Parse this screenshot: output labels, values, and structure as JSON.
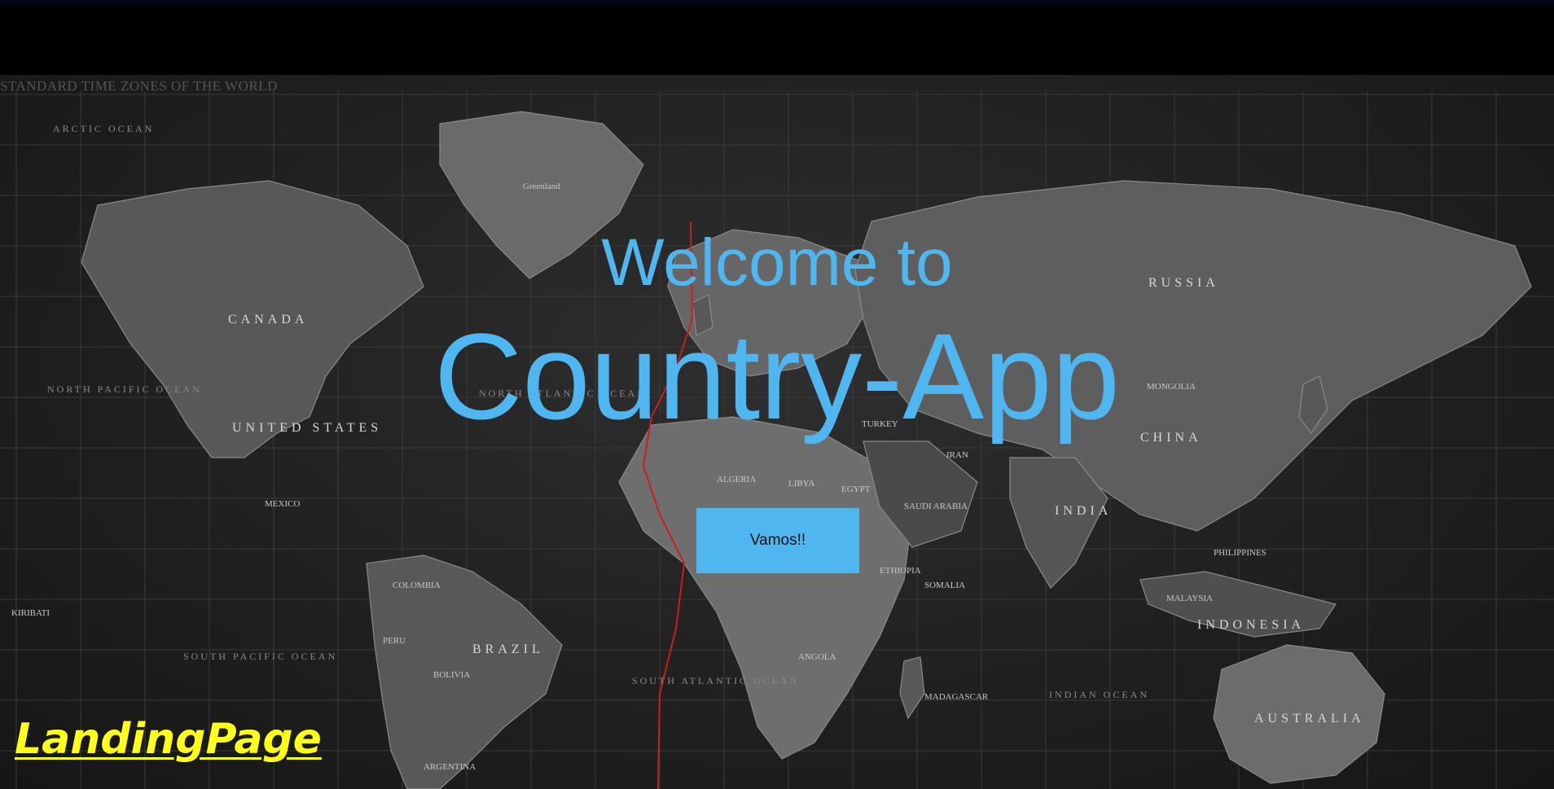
{
  "map": {
    "title": "STANDARD TIME ZONES OF THE WORLD",
    "labels": [
      {
        "text": "CANADA",
        "cls": "big"
      },
      {
        "text": "UNITED STATES",
        "cls": "big"
      },
      {
        "text": "RUSSIA",
        "cls": "big"
      },
      {
        "text": "CHINA",
        "cls": "big"
      },
      {
        "text": "BRAZIL",
        "cls": "big"
      },
      {
        "text": "INDIA",
        "cls": "big"
      },
      {
        "text": "AUSTRALIA",
        "cls": "big"
      },
      {
        "text": "INDONESIA",
        "cls": "big"
      },
      {
        "text": "MONGOLIA",
        "cls": "mid"
      },
      {
        "text": "Greenland",
        "cls": "mid"
      },
      {
        "text": "MEXICO",
        "cls": "mid"
      },
      {
        "text": "ALGERIA",
        "cls": "mid"
      },
      {
        "text": "LIBYA",
        "cls": "mid"
      },
      {
        "text": "EGYPT",
        "cls": "mid"
      },
      {
        "text": "SAUDI ARABIA",
        "cls": "mid"
      },
      {
        "text": "IRAN",
        "cls": "mid"
      },
      {
        "text": "ANGOLA",
        "cls": "mid"
      },
      {
        "text": "PERU",
        "cls": "mid"
      },
      {
        "text": "BOLIVIA",
        "cls": "mid"
      },
      {
        "text": "ARGENTINA",
        "cls": "mid"
      },
      {
        "text": "KIRIBATI",
        "cls": "mid"
      },
      {
        "text": "PHILIPPINES",
        "cls": "mid"
      },
      {
        "text": "MALAYSIA",
        "cls": "mid"
      },
      {
        "text": "ETHIOPIA",
        "cls": "mid"
      },
      {
        "text": "SOMALIA",
        "cls": "mid"
      },
      {
        "text": "MADAGASCAR",
        "cls": "mid"
      },
      {
        "text": "TURKEY",
        "cls": "mid"
      },
      {
        "text": "COLOMBIA",
        "cls": "mid"
      },
      {
        "text": "NORTH PACIFIC OCEAN",
        "cls": "ocean"
      },
      {
        "text": "SOUTH PACIFIC OCEAN",
        "cls": "ocean"
      },
      {
        "text": "NORTH ATLANTIC OCEAN",
        "cls": "ocean"
      },
      {
        "text": "SOUTH ATLANTIC OCEAN",
        "cls": "ocean"
      },
      {
        "text": "INDIAN OCEAN",
        "cls": "ocean"
      },
      {
        "text": "ARCTIC OCEAN",
        "cls": "ocean"
      }
    ]
  },
  "hero": {
    "welcome": "Welcome to",
    "app_name": "Country-App",
    "cta_label": "Vamos!!"
  },
  "footer": {
    "label": "LandingPage"
  },
  "colors": {
    "accent": "#4fb6ef",
    "label": "#ffff1a"
  }
}
